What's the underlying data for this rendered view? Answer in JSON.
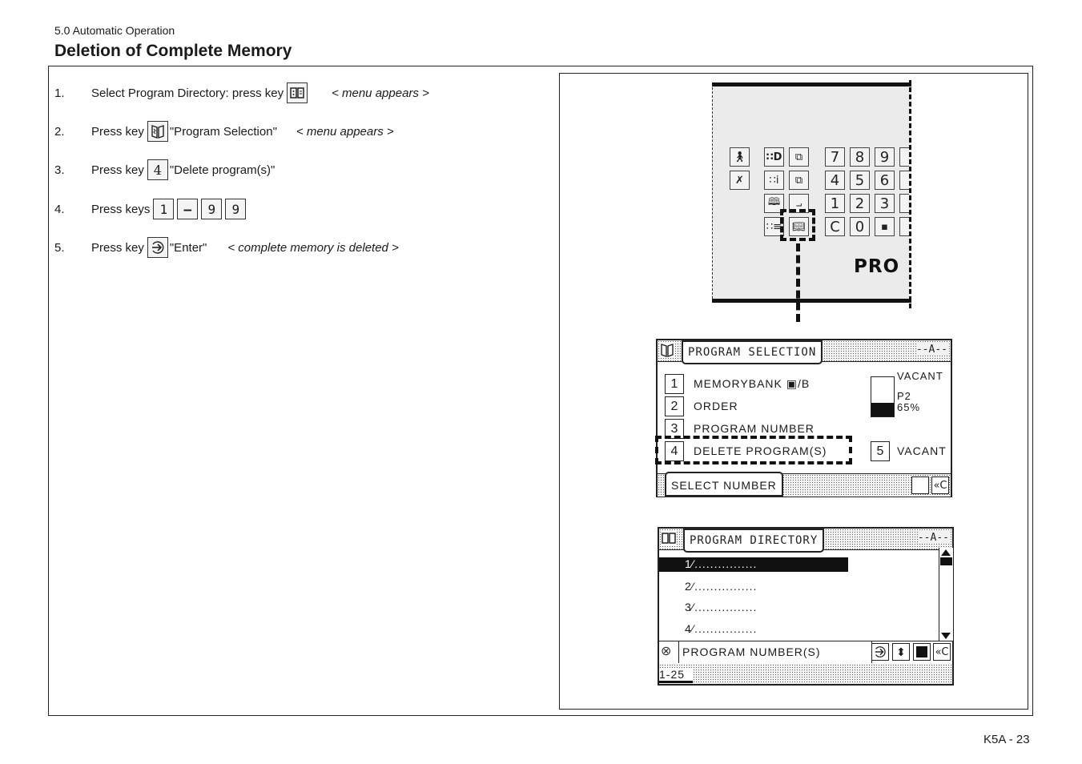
{
  "header": {
    "section": "5.0 Automatic Operation",
    "title": "Deletion of Complete Memory"
  },
  "steps": [
    {
      "num": "1.",
      "text_before": "Select Program Directory: press key",
      "key_icon": "program-directory-icon",
      "text_after": "",
      "note": "< menu appears >"
    },
    {
      "num": "2.",
      "text_before": "Press key",
      "key_icon": "program-selection-icon",
      "text_after": "\"Program Selection\"",
      "note": "< menu appears >"
    },
    {
      "num": "3.",
      "text_before": "Press key",
      "key_label": "4",
      "text_after": "\"Delete program(s)\"",
      "note": ""
    },
    {
      "num": "4.",
      "text_before": "Press keys",
      "keys": [
        "1",
        "—",
        "9",
        "9"
      ],
      "text_after": "",
      "note": ""
    },
    {
      "num": "5.",
      "text_before": "Press key",
      "key_icon": "enter-icon",
      "text_after": "\"Enter\"",
      "note": "< complete memory is deleted >"
    }
  ],
  "keyboard_panel": {
    "numeric_keys": [
      "7",
      "8",
      "9",
      "4",
      "5",
      "6",
      "1",
      "2",
      "3",
      "C",
      "0",
      "▪"
    ],
    "function_keys": [
      "operator-icon",
      "operator-crossed-icon",
      "program-d-icon",
      "window-transfer-icon",
      "program-info-icon",
      "window-copy-icon",
      "book-icon",
      "chart-icon",
      "directory-book-icon",
      "program-selection-icon"
    ],
    "brand_fragment": "PRO"
  },
  "program_selection_screen": {
    "title": "PROGRAM SELECTION",
    "mode": "--A--",
    "items": [
      {
        "key": "1",
        "label": "MEMORYBANK ▣/B"
      },
      {
        "key": "2",
        "label": "ORDER"
      },
      {
        "key": "3",
        "label": "PROGRAM NUMBER"
      },
      {
        "key": "4",
        "label": "DELETE PROGRAM(S)"
      }
    ],
    "side_item": {
      "key": "5",
      "label": "VACANT"
    },
    "gauge": {
      "label_top": "VACANT",
      "label_name": "P2",
      "label_value": "65%",
      "fill_fraction": 0.35
    },
    "footer_label": "SELECT NUMBER",
    "back_label": "«C"
  },
  "program_directory_screen": {
    "title": "PROGRAM DIRECTORY",
    "mode": "--A--",
    "rows": [
      "1⁄................",
      "2⁄................",
      "3⁄................",
      "4⁄................"
    ],
    "selected_index": 0,
    "prompt": "PROGRAM NUMBER(S)",
    "input_value": "1-25",
    "back_label": "«C"
  },
  "footer": {
    "page": "K5A - 23"
  }
}
